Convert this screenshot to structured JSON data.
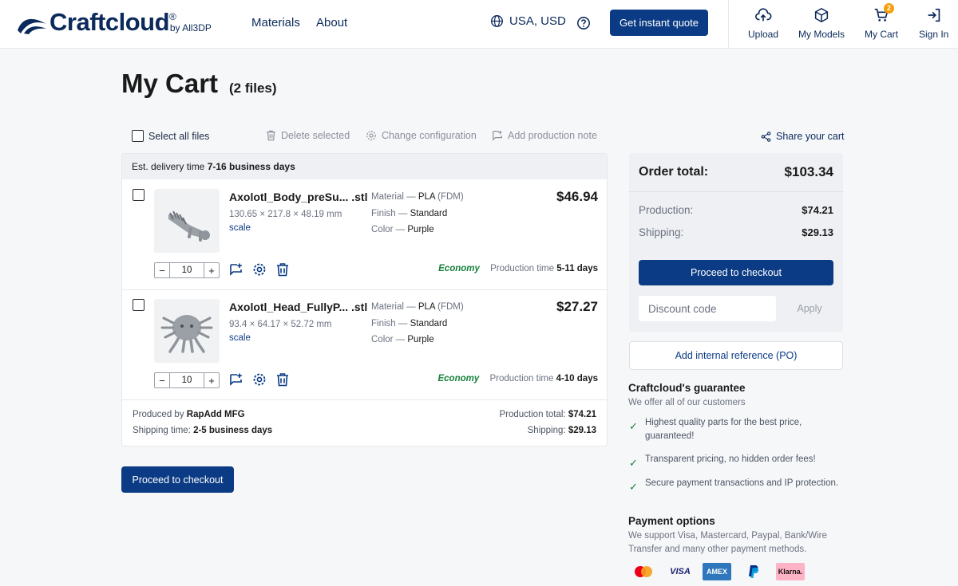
{
  "header": {
    "logo_text": "Craftcloud",
    "logo_reg": "®",
    "logo_by": "by All3DP",
    "nav": [
      "Materials",
      "About"
    ],
    "locale": "USA, USD",
    "quote_button": "Get instant quote",
    "upload": "Upload",
    "my_models": "My Models",
    "my_cart": "My Cart",
    "cart_count": "2",
    "sign_in": "Sign In"
  },
  "page": {
    "title": "My Cart",
    "file_count": "(2 files)"
  },
  "toolbar": {
    "select_all": "Select all files",
    "delete_selected": "Delete selected",
    "change_configuration": "Change configuration",
    "add_production_note": "Add production note",
    "share_cart": "Share your cart"
  },
  "cart": {
    "delivery_label": "Est. delivery time",
    "delivery_value": "7-16 business days",
    "items": [
      {
        "name": "Axolotl_Body_preSu... .stl",
        "dims": "130.65 × 217.8 × 48.19 mm",
        "scale": "scale",
        "material_label": "Material —",
        "material": "PLA",
        "material_type": "(FDM)",
        "finish_label": "Finish —",
        "finish": "Standard",
        "color_label": "Color —",
        "color": "Purple",
        "price": "$46.94",
        "qty": "10",
        "shipping_class": "Economy",
        "prod_time_label": "Production time",
        "prod_time": "5-11 days"
      },
      {
        "name": "Axolotl_Head_FullyP... .stl",
        "dims": "93.4 × 64.17 × 52.72 mm",
        "scale": "scale",
        "material_label": "Material —",
        "material": "PLA",
        "material_type": "(FDM)",
        "finish_label": "Finish —",
        "finish": "Standard",
        "color_label": "Color —",
        "color": "Purple",
        "price": "$27.27",
        "qty": "10",
        "shipping_class": "Economy",
        "prod_time_label": "Production time",
        "prod_time": "4-10 days"
      }
    ],
    "produced_by_label": "Produced by",
    "produced_by": "RapAdd MFG",
    "shipping_time_label": "Shipping time:",
    "shipping_time": "2-5 business days",
    "production_total_label": "Production total:",
    "production_total": "$74.21",
    "shipping_label": "Shipping:",
    "shipping": "$29.13",
    "checkout": "Proceed to checkout"
  },
  "summary": {
    "title": "Order total:",
    "total": "$103.34",
    "production_label": "Production:",
    "production": "$74.21",
    "shipping_label": "Shipping:",
    "shipping": "$29.13",
    "checkout": "Proceed to checkout",
    "discount_placeholder": "Discount code",
    "apply": "Apply",
    "po_button": "Add internal reference (PO)"
  },
  "guarantee": {
    "title": "Craftcloud's guarantee",
    "subtitle": "We offer all of our customers",
    "items": [
      "Highest quality parts for the best price, guaranteed!",
      "Transparent pricing, no hidden order fees!",
      "Secure payment transactions and IP protection."
    ]
  },
  "payment": {
    "title": "Payment options",
    "text": "We support Visa, Mastercard, Paypal, Bank/Wire Transfer and many other payment methods.",
    "methods": [
      "mastercard-icon",
      "VISA",
      "AMEX",
      "paypal-icon",
      "Klarna."
    ]
  },
  "colors": {
    "brand_navy": "#0b3b84",
    "economy_green": "#16803c",
    "badge_orange": "#f59e0b"
  }
}
